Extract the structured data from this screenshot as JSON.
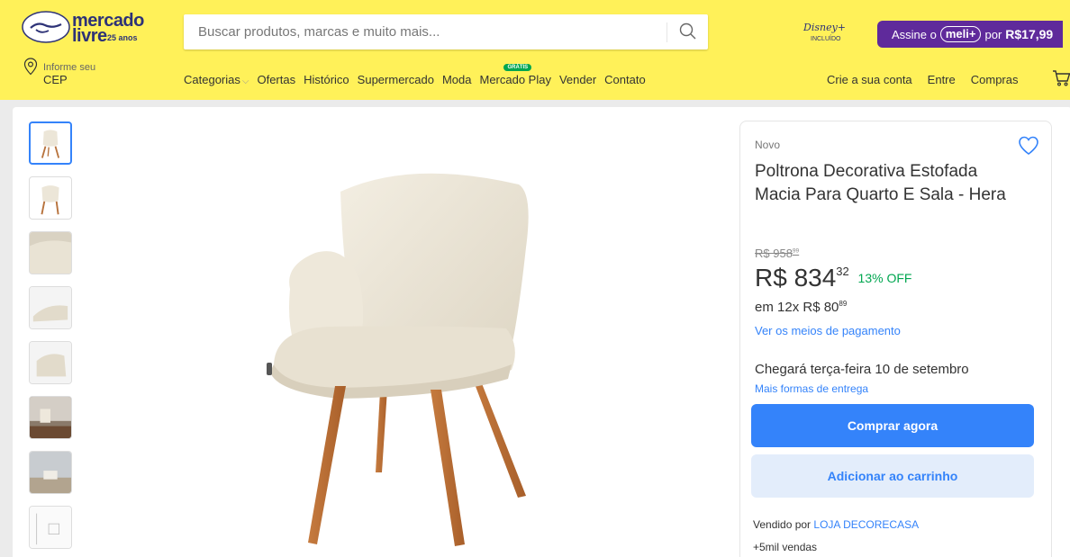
{
  "header": {
    "logo_line1": "mercado",
    "logo_line2": "livre",
    "logo_badge": "25 anos",
    "search_placeholder": "Buscar produtos, marcas e muito mais...",
    "disney_logo": "Disney+",
    "disney_label": "INCLUÍDO",
    "meli_prefix": "Assine o",
    "meli_pill": "meli+",
    "meli_suffix": "por",
    "meli_price": "R$17,99",
    "cep_line1": "Informe seu",
    "cep_line2": "CEP",
    "nav": [
      "Categorias",
      "Ofertas",
      "Histórico",
      "Supermercado",
      "Moda",
      "Mercado Play",
      "Vender",
      "Contato"
    ],
    "gratis_badge": "GRÁTIS",
    "nav_right": [
      "Crie a sua conta",
      "Entre",
      "Compras"
    ],
    "brand_color": "#fff159",
    "accent_color": "#3483fa"
  },
  "gallery": {
    "thumbnail_count": 8,
    "active_index": 0
  },
  "product": {
    "condition": "Novo",
    "title": "Poltrona Decorativa Estofada Macia Para Quarto E Sala - Hera",
    "old_price_int": "R$ 958",
    "old_price_cents": "99",
    "price_int": "R$ 834",
    "price_cents": "32",
    "discount": "13% OFF",
    "installments_prefix": "em 12x R$ 80",
    "installments_cents": "89",
    "payment_link": "Ver os meios de pagamento",
    "delivery": "Chegará terça-feira 10 de setembro",
    "delivery_link": "Mais formas de entrega",
    "buy_button": "Comprar agora",
    "cart_button": "Adicionar ao carrinho",
    "seller_prefix": "Vendido por",
    "seller_name": "LOJA DECORECASA",
    "sales": "+5mil vendas"
  }
}
